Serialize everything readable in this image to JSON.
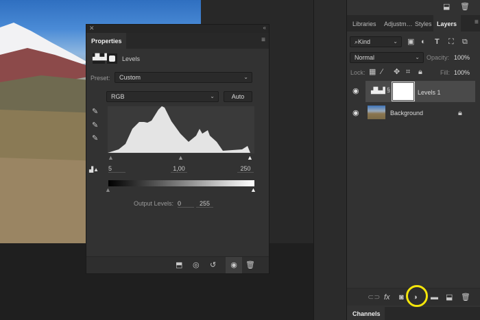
{
  "properties": {
    "title": "Properties",
    "adjustment": "Levels",
    "preset_label": "Preset:",
    "preset_value": "Custom",
    "channel": "RGB",
    "auto_button": "Auto",
    "input_levels": {
      "black": "5",
      "gamma": "1,00",
      "white": "250"
    },
    "output_levels_label": "Output Levels:",
    "output_levels": {
      "black": "0",
      "white": "255"
    },
    "footer_icons": [
      "clip-to-layer-icon",
      "view-previous-icon",
      "reset-icon",
      "visibility-icon",
      "delete-icon"
    ]
  },
  "layers_panel": {
    "tabs": [
      "Libraries",
      "Adjustm…",
      "Styles",
      "Layers"
    ],
    "active_tab": "Layers",
    "filter_kind": "Kind",
    "blend_mode": "Normal",
    "opacity_label": "Opacity:",
    "opacity": "100%",
    "lock_label": "Lock:",
    "fill_label": "Fill:",
    "fill": "100%",
    "layers": [
      {
        "name": "Levels 1",
        "type": "adjustment",
        "visible": true,
        "selected": true
      },
      {
        "name": "Background",
        "type": "image",
        "visible": true,
        "locked": true
      }
    ],
    "footer_icons": [
      "link-icon",
      "fx-icon",
      "mask-icon",
      "adjustment-layer-icon",
      "folder-icon",
      "new-layer-icon",
      "trash-icon"
    ],
    "highlight_color": "#f5e60a"
  },
  "channels_panel": {
    "title": "Channels"
  }
}
